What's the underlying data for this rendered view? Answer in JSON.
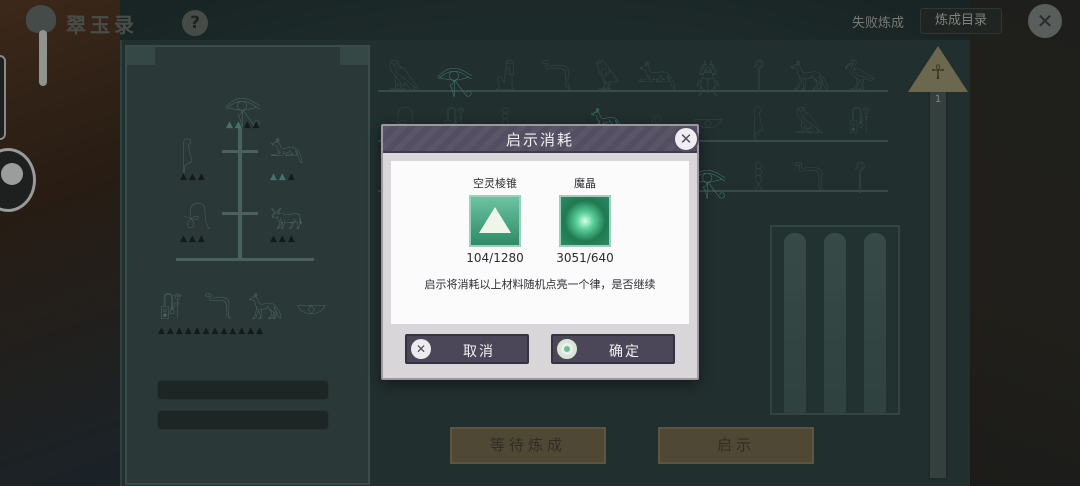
{
  "header": {
    "app_title": "翠玉录",
    "help_icon": "question-mark-icon",
    "fail_link": "失败炼成",
    "catalog_button": "炼成目录",
    "close_icon": "close-icon"
  },
  "scene": {
    "level": "1",
    "bottom_buttons": [
      "等待炼成",
      "启示"
    ]
  },
  "dialog": {
    "title": "启示消耗",
    "close_icon": "close-icon",
    "materials": [
      {
        "name": "空灵棱锥",
        "count": "104/1280",
        "icon": "pyramid-crystal-icon"
      },
      {
        "name": "魔晶",
        "count": "3051/640",
        "icon": "magic-crystal-icon"
      }
    ],
    "description": "启示将消耗以上材料随机点亮一个律，是否继续",
    "cancel_label": "取消",
    "confirm_label": "确定"
  },
  "colors": {
    "dialog_header": "#534e61",
    "dialog_button": "#4b4758",
    "scene_teal": "#2f4543",
    "lit_glyph": "#63b3a9",
    "gold_button": "#7a6d4e"
  }
}
